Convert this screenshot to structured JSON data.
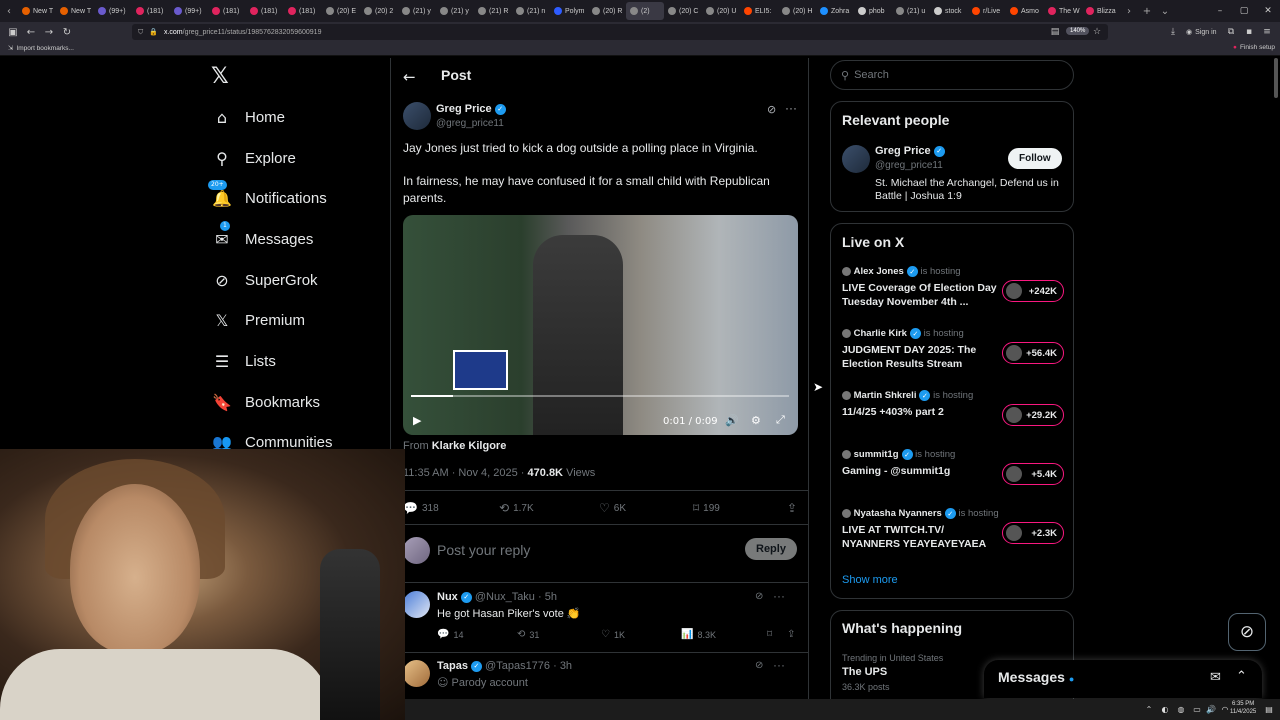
{
  "browser": {
    "tabs": [
      {
        "label": "New T",
        "color": "#e66000"
      },
      {
        "label": "New T",
        "color": "#e66000"
      },
      {
        "label": "(99+)",
        "color": "#6a5acd"
      },
      {
        "label": "(181)",
        "color": "#e0245e"
      },
      {
        "label": "(99+)",
        "color": "#6a5acd"
      },
      {
        "label": "(181)",
        "color": "#e0245e"
      },
      {
        "label": "(181)",
        "color": "#e0245e"
      },
      {
        "label": "(181)",
        "color": "#e0245e"
      },
      {
        "label": "(20) E",
        "color": "#888888"
      },
      {
        "label": "(20) 2",
        "color": "#888888"
      },
      {
        "label": "(21) y",
        "color": "#888888"
      },
      {
        "label": "(21) y",
        "color": "#888888"
      },
      {
        "label": "(21) R",
        "color": "#888888"
      },
      {
        "label": "(21) n",
        "color": "#888888"
      },
      {
        "label": "Polym",
        "color": "#2e5cff"
      },
      {
        "label": "(20) R",
        "color": "#888888"
      },
      {
        "label": "(2)",
        "color": "#888888"
      },
      {
        "label": "(20) C",
        "color": "#888888"
      },
      {
        "label": "(20) U",
        "color": "#888888"
      },
      {
        "label": "ELI5:",
        "color": "#ff4500"
      },
      {
        "label": "(20) H",
        "color": "#888888"
      },
      {
        "label": "Zohra",
        "color": "#1e90ff"
      },
      {
        "label": "phob",
        "color": "#cccccc"
      },
      {
        "label": "(21) u",
        "color": "#888888"
      },
      {
        "label": "stock",
        "color": "#cccccc"
      },
      {
        "label": "r/Live",
        "color": "#ff4500"
      },
      {
        "label": "Asmo",
        "color": "#ff4500"
      },
      {
        "label": "The W",
        "color": "#e0245e"
      },
      {
        "label": "Blizza",
        "color": "#e0245e"
      }
    ],
    "url_host": "x.com",
    "url_path": "/greg_price11/status/1985762832059600919",
    "zoom": "140%",
    "signin": "Sign in",
    "bookmark": "Import bookmarks...",
    "finish_setup": "Finish setup"
  },
  "nav": {
    "items": [
      {
        "label": "Home",
        "icon": "home-icon",
        "glyph": "⌂"
      },
      {
        "label": "Explore",
        "icon": "search-icon",
        "glyph": "⚲"
      },
      {
        "label": "Notifications",
        "icon": "bell-icon",
        "glyph": "🔔"
      },
      {
        "label": "Messages",
        "icon": "mail-icon",
        "glyph": "✉"
      },
      {
        "label": "SuperGrok",
        "icon": "grok-icon",
        "glyph": "⊘"
      },
      {
        "label": "Premium",
        "icon": "x-icon",
        "glyph": "𝕏"
      },
      {
        "label": "Lists",
        "icon": "list-icon",
        "glyph": "☰"
      },
      {
        "label": "Bookmarks",
        "icon": "bookmark-icon",
        "glyph": "🔖"
      },
      {
        "label": "Communities",
        "icon": "people-icon",
        "glyph": "👥"
      }
    ],
    "notifications_badge": "20+",
    "messages_badge": "1"
  },
  "post": {
    "header": "Post",
    "author_name": "Greg Price",
    "author_handle": "@greg_price11",
    "text1": "Jay Jones just tried to kick a dog outside a polling place in Virginia.",
    "text2": "In fairness, he may have confused it for a small child with Republican parents.",
    "video_time": "0:01 / 0:09",
    "video_progress": 0.11,
    "from_label": "From",
    "from_name": "Klarke Kilgore",
    "timestamp": "11:35 AM · Nov 4, 2025 · ",
    "views": "470.8K",
    "views_label": "Views",
    "replies": "318",
    "reposts": "1.7K",
    "likes": "6K",
    "bookmarks": "199"
  },
  "reply_box": {
    "placeholder": "Post your reply",
    "button": "Reply"
  },
  "replies": [
    {
      "name": "Nux",
      "handle": "@Nux_Taku · 5h",
      "text": "He got Hasan Piker's vote 👏",
      "replies": "14",
      "reposts": "31",
      "likes": "1K",
      "views": "8.3K"
    },
    {
      "name": "Tapas",
      "handle": "@Tapas1776 · 3h",
      "text": "Parody account"
    }
  ],
  "search": {
    "placeholder": "Search"
  },
  "relevant": {
    "title": "Relevant people",
    "name": "Greg Price",
    "handle": "@greg_price11",
    "bio": "St. Michael the Archangel, Defend us in Battle | Joshua 1:9",
    "follow": "Follow"
  },
  "live": {
    "title": "Live on X",
    "hosting": "is hosting",
    "items": [
      {
        "host": "Alex Jones",
        "title": "LIVE Coverage Of Election Day Tuesday November 4th ...",
        "count": "+242K"
      },
      {
        "host": "Charlie Kirk",
        "title": "JUDGMENT DAY 2025: The Election Results Stream",
        "count": "+56.4K"
      },
      {
        "host": "Martin Shkreli",
        "title": "11/4/25 +403% part 2",
        "count": "+29.2K"
      },
      {
        "host": "summit1g",
        "title": "Gaming - @summit1g",
        "count": "+5.4K"
      },
      {
        "host": "Nyatasha Nyanners",
        "title": "LIVE AT TWITCH.TV/ NYANNERS YEAYEAYEYAEA",
        "count": "+2.3K"
      }
    ],
    "show_more": "Show more"
  },
  "happening": {
    "title": "What's happening",
    "trend_context": "Trending in United States",
    "trend_name": "The UPS",
    "trend_posts": "36.3K posts"
  },
  "messages_drawer": {
    "title": "Messages"
  },
  "system": {
    "time": "6:35 PM",
    "date": "11/4/2025"
  }
}
